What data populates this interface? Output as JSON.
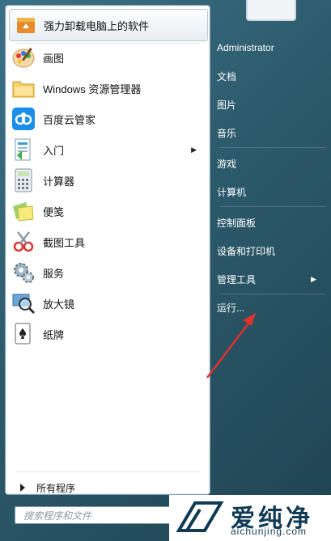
{
  "pinned": {
    "label": "强力卸载电脑上的软件",
    "icon": "uninstall-box-icon"
  },
  "programs": [
    {
      "label": "画图",
      "icon": "paint-icon"
    },
    {
      "label": "Windows 资源管理器",
      "icon": "folder-explorer-icon"
    },
    {
      "label": "百度云管家",
      "icon": "baidu-cloud-icon"
    },
    {
      "label": "入门",
      "icon": "getting-started-icon"
    },
    {
      "label": "计算器",
      "icon": "calculator-icon"
    },
    {
      "label": "便笺",
      "icon": "sticky-notes-icon"
    },
    {
      "label": "截图工具",
      "icon": "snipping-tool-icon"
    },
    {
      "label": "服务",
      "icon": "services-gear-icon"
    },
    {
      "label": "放大镜",
      "icon": "magnifier-icon"
    },
    {
      "label": "纸牌",
      "icon": "solitaire-icon"
    }
  ],
  "all_programs": "所有程序",
  "search": {
    "placeholder": "搜索程序和文件"
  },
  "right_menu": [
    "Administrator",
    "文档",
    "图片",
    "音乐",
    "游戏",
    "计算机",
    "控制面板",
    "设备和打印机",
    "管理工具",
    "运行..."
  ],
  "watermark": {
    "brand": "爱纯净",
    "url": "aichunjing.com"
  },
  "colors": {
    "arrow": "#e0312f",
    "menu_bg": "#2c5a6b",
    "left_panel": "#ffffff"
  }
}
